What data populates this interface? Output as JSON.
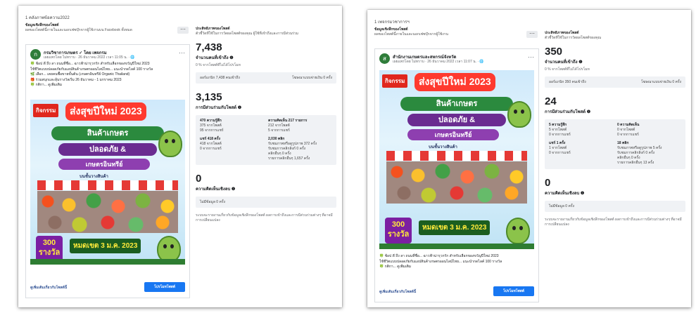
{
  "left": {
    "page_label": "1 คลังภาพข้อความ2022",
    "header_title": "ข้อมูลเชิงลึกของโพสต์",
    "header_text": "ผลของโพสต์นี้ภายในและนอกเฟซบุ๊กจากผู้ใช้งานบน Facebook ทั้งหมด",
    "post": {
      "avatar_letter": "ก",
      "page_name": "กรมวิชาการเกษตร ✓ โดย เพจกรม",
      "meta": "เผยแพร่โดย ไม่ทราบ · 26 ธันวาคม 2022 เวลา 11:05 น. · 🌐",
      "caption": [
        "🍀 ช้อป ดี ถึง ลา ถนนที่ชื่อ... ฉาวฟ้าน่ารุวกรัก สำหรับเลือกของขวัญปีใหม่ 2023",
        "ใช้ชีวิตแบบปลอดภัยกับแอปสินค้าเกษตรออนไลน์ไทย... แนะนำกดไลค์ 100 รางวัล",
        "🌿 เลือก... เคยคนซื้อขายขั้นต้น (เกษตรอินทรีย์ Organic Thailand)",
        "🎁 ร่วมสนุกและลุ้นรางวัลเริ่ม 26 ธันวาคม - 1 มกราคม 2023",
        "🍀 กติกา... ดูเพิ่มเติม"
      ],
      "poster": {
        "tag": "กิจกรรม",
        "headline": "ส่งสุขปีใหม่ 2023",
        "line1": "สินค้าเกษตร",
        "line2": "ปลอดภัย &",
        "line3": "เกษตรอินทรีย์",
        "sub": "บนชั้นวางสินค้า",
        "prize": "300 รางวัล",
        "deadline": "หมดเขต 3 ม.ค. 2023"
      },
      "boost_link": "ดูเพิ่มเติมเกี่ยวกับโพสต์นี้",
      "boost_button": "โปรโมทโพสต์"
    },
    "insights": {
      "title": "ประสิทธิภาพของโพสต์",
      "desc": "ตัวชี้วัดที่ใช้ในการวัดผลโพสต์ของคุณ ผู้ใช้ที่เข้าถึงและการมีส่วนร่วม",
      "reach": {
        "value": "7,438",
        "label": "จำนวนคนที่เข้าถึง ❶",
        "note": "0 % จากโพสต์ที่ไม่ได้โปรโมท",
        "organic": "ออร์แกนิก 7,438 คนเข้าถึง",
        "paid": "โฆษณาแบบจ่ายเงิน 0 ครั้ง"
      },
      "engage": {
        "value": "3,135",
        "label": "การมีส่วนร่วมกับโพสต์ ❶",
        "c1_head": "470 ความรู้สึก",
        "c1a": "375 จากโพสต์",
        "c1b": "95 จากการแชร์",
        "c2_head": "ความคิดเห็น 217 รายการ",
        "c2a": "212 จากโพสต์",
        "c2b": "5 จากการแชร์",
        "c3_head": "แชร์ 418 ครั้ง",
        "c3a": "418 จากโพสต์",
        "c3b": "0 จากการแชร์",
        "c4_head": "2,030 คลิก",
        "c4a": "รับชมภาพหรือดูรูปภาพ 372 ครั้ง",
        "c4b": "รับชมการคลิกลิงก์ 0 ครั้ง",
        "c4c": "คลิกอื่นๆ 0 ครั้ง",
        "c4d": "รายการคลิกอื่นๆ 1,657 ครั้ง"
      },
      "negative": {
        "value": "0",
        "label": "ความคิดเห็นเชิงลบ ❶",
        "box": "ไม่มีข้อมูล 0 ครั้ง"
      },
      "footnote": "ระบบจะรายงานเกี่ยวกับข้อมูลเชิงลึกของโพสต์ ผลการเข้าถึงและการมีส่วนร่วมต่างๆ ที่อาจมีการเปลี่ยนแปลง"
    }
  },
  "right": {
    "page_label": "1 เพจกรมวชาการฯ",
    "header_title": "ข้อมูลเชิงลึกของโพสต์",
    "header_text": "ผลของโพสต์นี้ภายในและนอกเฟซบุ๊กจากผู้ใช้งาน",
    "post": {
      "avatar_letter": "ส",
      "page_name": "สำนักงานเกษตรและสหกรณ์จังหวัด",
      "meta": "เผยแพร่โดย ไม่ทราบ · 26 ธันวาคม 2022 เวลา 11:07 น. · 🌐",
      "caption": [
        "🍀 ช้อป ดี ถึง ลา ถนนที่ชื่อ... ฉาวฟ้าน่ารุวกรัก สำหรับเลือกของขวัญปีใหม่ 2023",
        "ใช้ชีวิตแบบปลอดภัยกับแอปสินค้าเกษตรออนไลน์ไทย... แนะนำกดไลค์ 100 รางวัล",
        "🍀 กติกา... ดูเพิ่มเติม"
      ],
      "poster": {
        "tag": "กิจกรรม",
        "headline": "ส่งสุขปีใหม่ 2023",
        "line1": "สินค้าเกษตร",
        "line2": "ปลอดภัย &",
        "line3": "เกษตรอินทรีย์",
        "sub": "บนชั้นวางสินค้า",
        "prize": "300 รางวัล",
        "deadline": "หมดเขต 3 ม.ค. 2023"
      },
      "boost_link": "ดูเพิ่มเติมเกี่ยวกับโพสต์นี้",
      "boost_button": "โปรโมทโพสต์"
    },
    "insights": {
      "title": "ประสิทธิภาพของโพสต์",
      "desc": "ตัวชี้วัดที่ใช้ในการวัดผลโพสต์ของคุณ",
      "reach": {
        "value": "350",
        "label": "จำนวนคนที่เข้าถึง ❶",
        "note": "0 % จากโพสต์ที่ไม่ได้โปรโมท",
        "organic": "ออร์แกนิก 350 คนเข้าถึง",
        "paid": "โฆษณาแบบจ่ายเงิน 0 ครั้ง"
      },
      "engage": {
        "value": "24",
        "label": "การมีส่วนร่วมกับโพสต์ ❶",
        "c1_head": "5 ความรู้สึก",
        "c1a": "5 จากโพสต์",
        "c1b": "0 จากการแชร์",
        "c2_head": "0 ความคิดเห็น",
        "c2a": "0 จากโพสต์",
        "c2b": "0 จากการแชร์",
        "c3_head": "แชร์ 1 ครั้ง",
        "c3a": "1 จากโพสต์",
        "c3b": "0 จากการแชร์",
        "c4_head": "18 คลิก",
        "c4a": "รับชมภาพหรือดูรูปภาพ 5 ครั้ง",
        "c4b": "รับชมการคลิกลิงก์ 0 ครั้ง",
        "c4c": "คลิกอื่นๆ 0 ครั้ง",
        "c4d": "รายการคลิกอื่นๆ 13 ครั้ง"
      },
      "negative": {
        "value": "0",
        "label": "ความคิดเห็นเชิงลบ ❶",
        "box": "ไม่มีข้อมูล 0 ครั้ง"
      },
      "footnote": "ระบบจะรายงานเกี่ยวกับข้อมูลเชิงลึกของโพสต์ ผลการเข้าถึงและการมีส่วนร่วมต่างๆ ที่อาจมีการเปลี่ยนแปลง"
    }
  },
  "colors": {
    "accent": "#1877f2",
    "panel": "#f0f2f5",
    "poster_red": "#e0271d",
    "poster_green": "#2b8a3e"
  },
  "icons": {
    "more": "more-horizontal-icon",
    "globe": "globe-icon",
    "info": "info-icon"
  }
}
